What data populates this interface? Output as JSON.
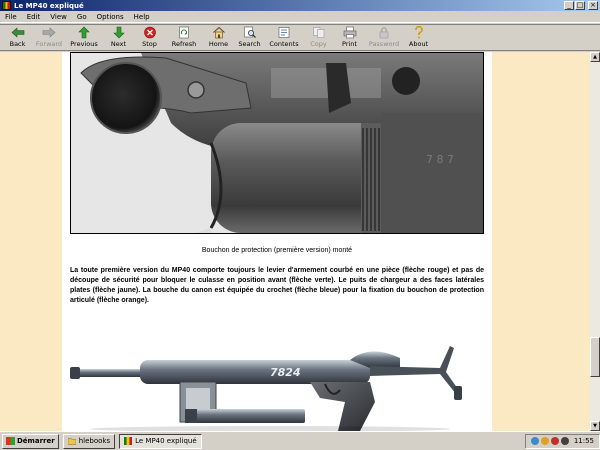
{
  "window": {
    "title": "Le MP40 expliqué"
  },
  "menu": [
    "File",
    "Edit",
    "View",
    "Go",
    "Options",
    "Help"
  ],
  "toolbar": [
    {
      "label": "Back",
      "icon": "back-arrow-icon",
      "enabled": true
    },
    {
      "label": "Forward",
      "icon": "forward-arrow-icon",
      "enabled": false
    },
    {
      "label": "Previous",
      "icon": "up-arrow-icon",
      "enabled": true
    },
    {
      "label": "Next",
      "icon": "down-arrow-icon",
      "enabled": true
    },
    {
      "label": "Stop",
      "icon": "stop-icon",
      "enabled": true
    },
    {
      "label": "Refresh",
      "icon": "refresh-icon",
      "enabled": true
    },
    {
      "label": "Home",
      "icon": "home-icon",
      "enabled": true
    },
    {
      "label": "Search",
      "icon": "search-icon",
      "enabled": true
    },
    {
      "label": "Contents",
      "icon": "contents-icon",
      "enabled": true
    },
    {
      "label": "Copy",
      "icon": "copy-icon",
      "enabled": false
    },
    {
      "label": "Print",
      "icon": "print-icon",
      "enabled": true
    },
    {
      "label": "Password",
      "icon": "password-icon",
      "enabled": false
    },
    {
      "label": "About",
      "icon": "about-icon",
      "enabled": true
    }
  ],
  "content": {
    "caption": "Bouchon de protection (première version) monté",
    "paragraph": "La toute première version du MP40 comporte toujours le levier d'armement courbé en une pièce (flèche rouge) et pas de découpe de sécurité pour bloquer le culasse en position avant (flèche verte). Le puits de chargeur a des faces latérales plates (flèche jaune). La bouche du canon est équipée du crochet (flèche bleue) pour la fixation du bouchon de protection articulé (flèche orange).",
    "gun_serial": "7824"
  },
  "colors": {
    "page_background": "#fae9c3",
    "titlebar_start": "#0a246a",
    "titlebar_end": "#a6caf0"
  },
  "taskbar": {
    "start_label": "Démarrer",
    "tasks": [
      {
        "label": "hlebooks",
        "active": false
      },
      {
        "label": "Le MP40 expliqué",
        "active": true
      }
    ],
    "clock": "11:55"
  }
}
